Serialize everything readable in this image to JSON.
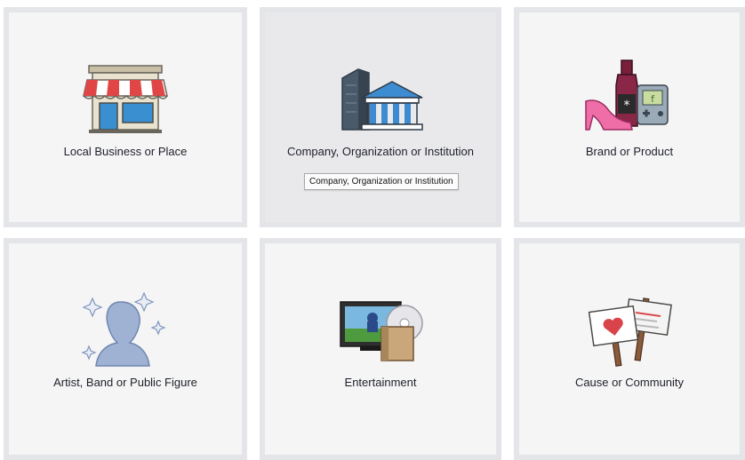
{
  "categories": [
    {
      "label": "Local Business or Place",
      "icon": "storefront-icon"
    },
    {
      "label": "Company, Organization or Institution",
      "icon": "buildings-icon",
      "tooltip": "Company, Organization or Institution"
    },
    {
      "label": "Brand or Product",
      "icon": "products-icon"
    },
    {
      "label": "Artist, Band or Public Figure",
      "icon": "public-figure-icon"
    },
    {
      "label": "Entertainment",
      "icon": "entertainment-icon"
    },
    {
      "label": "Cause or Community",
      "icon": "signs-icon"
    }
  ],
  "colors": {
    "tile_background": "#f5f5f5",
    "tile_hover_background": "#e9e9ec",
    "tile_border": "#e4e5e8",
    "label_text": "#1d2129"
  }
}
